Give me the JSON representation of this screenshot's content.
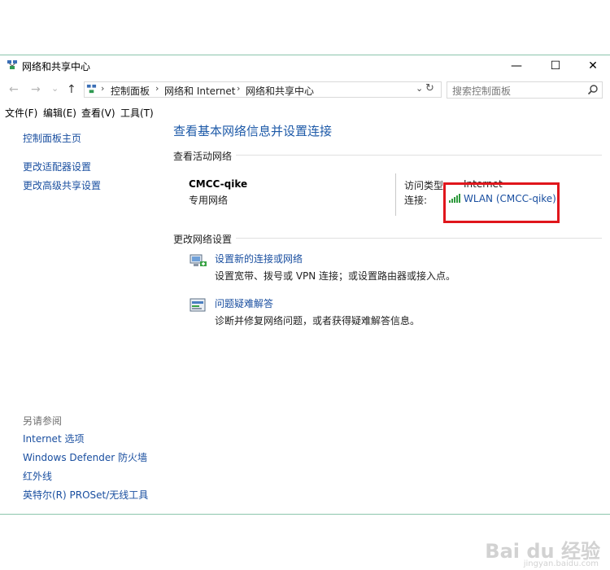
{
  "window": {
    "title": "网络和共享中心",
    "controls": {
      "minimize": "—",
      "maximize": "☐",
      "close": "✕"
    }
  },
  "nav": {
    "back": "←",
    "forward": "→",
    "recent": "⌄",
    "up": "↑",
    "breadcrumb": [
      "控制面板",
      "网络和 Internet",
      "网络和共享中心"
    ],
    "dropdown": "⌄",
    "refresh": "↻"
  },
  "search": {
    "placeholder": "搜索控制面板"
  },
  "menu": [
    "文件(F)",
    "编辑(E)",
    "查看(V)",
    "工具(T)"
  ],
  "sidebar": {
    "links": [
      "控制面板主页",
      "更改适配器设置",
      "更改高级共享设置"
    ],
    "see_also_label": "另请参阅",
    "see_also": [
      "Internet 选项",
      "Windows Defender 防火墙",
      "红外线",
      "英特尔(R) PROSet/无线工具"
    ]
  },
  "main": {
    "title": "查看基本网络信息并设置连接",
    "active_networks_label": "查看活动网络",
    "network": {
      "name": "CMCC-qike",
      "type": "专用网络",
      "access_type_label": "访问类型:",
      "access_type_value": "Internet",
      "connections_label": "连接:",
      "connection_link": "WLAN (CMCC-qike)"
    },
    "change_settings_label": "更改网络设置",
    "tasks": [
      {
        "link": "设置新的连接或网络",
        "desc": "设置宽带、拨号或 VPN 连接；或设置路由器或接入点。"
      },
      {
        "link": "问题疑难解答",
        "desc": "诊断并修复网络问题，或者获得疑难解答信息。"
      }
    ]
  },
  "watermark": {
    "text": "Bai du 经验",
    "sub": "jingyan.baidu.com"
  },
  "colors": {
    "link": "#1a4fa0",
    "heading": "#1e5aa8",
    "highlight_box": "#e0161c",
    "window_border": "#8cc5ac"
  }
}
